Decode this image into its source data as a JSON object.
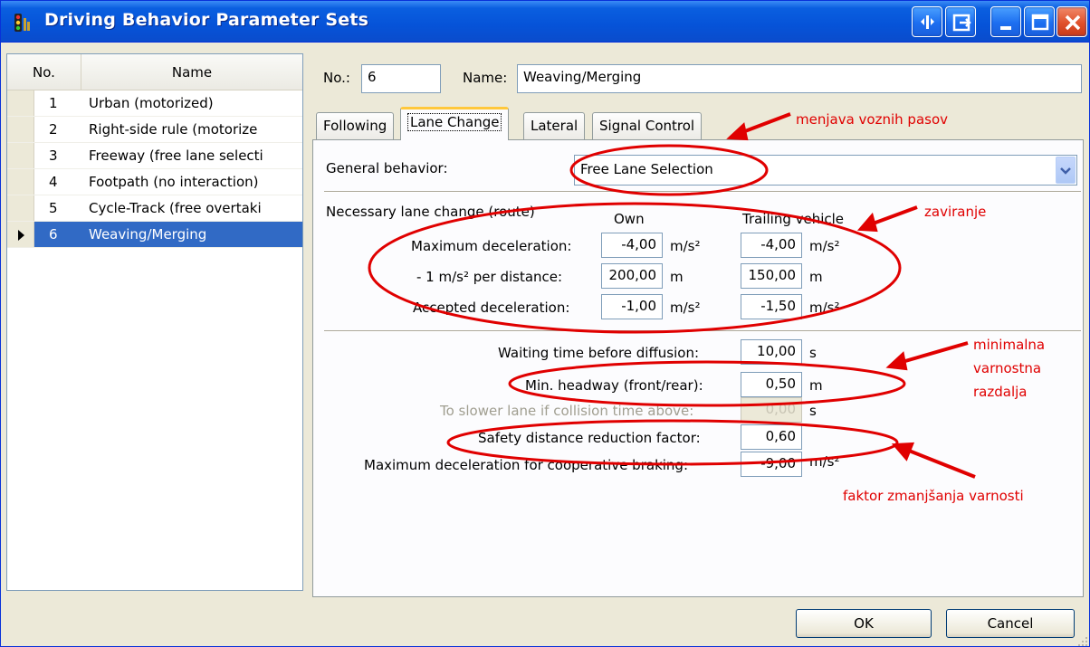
{
  "window": {
    "title": "Driving Behavior Parameter Sets"
  },
  "list": {
    "header_no": "No.",
    "header_name": "Name",
    "rows": [
      {
        "no": "1",
        "name": "Urban (motorized)"
      },
      {
        "no": "2",
        "name": "Right-side rule (motorize"
      },
      {
        "no": "3",
        "name": "Freeway (free lane selecti"
      },
      {
        "no": "4",
        "name": "Footpath (no interaction)"
      },
      {
        "no": "5",
        "name": "Cycle-Track (free overtaki"
      },
      {
        "no": "6",
        "name": "Weaving/Merging"
      }
    ],
    "selected_index": 5
  },
  "header": {
    "no_label": "No.:",
    "no_value": "6",
    "name_label": "Name:",
    "name_value": "Weaving/Merging"
  },
  "tabs": [
    {
      "label": "Following"
    },
    {
      "label": "Lane Change"
    },
    {
      "label": "Lateral"
    },
    {
      "label": "Signal Control"
    }
  ],
  "active_tab": "Lane Change",
  "lane_change": {
    "general_behavior_label": "General behavior:",
    "general_behavior_value": "Free Lane Selection",
    "necessary_label": "Necessary lane change (route)",
    "col_own": "Own",
    "col_trailing": "Trailing vehicle",
    "rows": [
      {
        "label": "Maximum deceleration:",
        "own": "-4,00",
        "own_unit": "m/s²",
        "trail": "-4,00",
        "trail_unit": "m/s²"
      },
      {
        "label": "- 1 m/s² per distance:",
        "own": "200,00",
        "own_unit": "m",
        "trail": "150,00",
        "trail_unit": "m"
      },
      {
        "label": "Accepted deceleration:",
        "own": "-1,00",
        "own_unit": "m/s²",
        "trail": "-1,50",
        "trail_unit": "m/s²"
      }
    ],
    "params": [
      {
        "label": "Waiting time before diffusion:",
        "value": "10,00",
        "unit": "s",
        "disabled": false
      },
      {
        "label": "Min. headway (front/rear):",
        "value": "0,50",
        "unit": "m",
        "disabled": false
      },
      {
        "label": "To slower lane if collision time above:",
        "value": "0,00",
        "unit": "s",
        "disabled": true
      },
      {
        "label": "Safety distance reduction factor:",
        "value": "0,60",
        "unit": "",
        "disabled": false
      },
      {
        "label": "Maximum deceleration for cooperative braking:",
        "value": "-9,00",
        "unit": "m/s²",
        "disabled": false
      }
    ]
  },
  "buttons": {
    "ok": "OK",
    "cancel": "Cancel"
  },
  "annotations": {
    "lane_change": "menjava voznih pasov",
    "braking": "zaviranje",
    "min_distance_1": "minimalna",
    "min_distance_2": "varnostna",
    "min_distance_3": "razdalja",
    "reduction": "faktor zmanjšanja varnosti",
    "color": "#e00000"
  },
  "icons": {
    "app": "traffic-light-icon",
    "title_buttons": [
      "restore-side-icon",
      "export-icon",
      "minimize-icon",
      "maximize-icon",
      "close-icon"
    ]
  }
}
